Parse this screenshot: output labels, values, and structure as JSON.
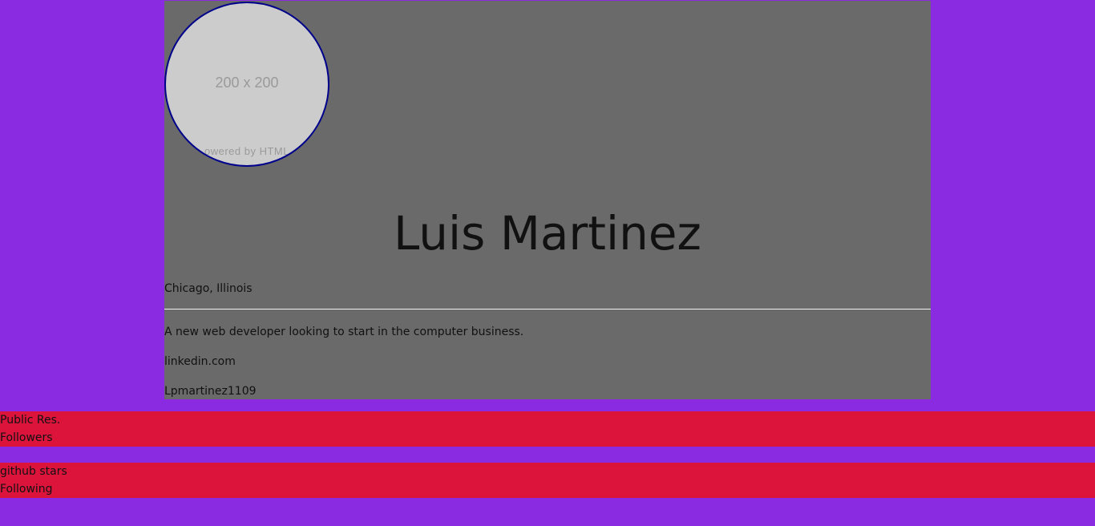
{
  "profile": {
    "avatar": {
      "size_label": "200 x 200",
      "powered_label": "owered by HTML"
    },
    "name": "Luis Martinez",
    "location": "Chicago, Illinois",
    "bio": "A new web developer looking to start in the computer business.",
    "linkedin": "linkedin.com",
    "github_handle": "Lpmartinez1109"
  },
  "stats": {
    "row1": {
      "first": "Public Res.",
      "second": "Followers"
    },
    "row2": {
      "first": "github stars",
      "second": "Following"
    }
  },
  "colors": {
    "page_background": "#8a2be2",
    "card_background": "#6a6a6a",
    "stats_background": "#dc143c",
    "avatar_border": "#00008b"
  }
}
